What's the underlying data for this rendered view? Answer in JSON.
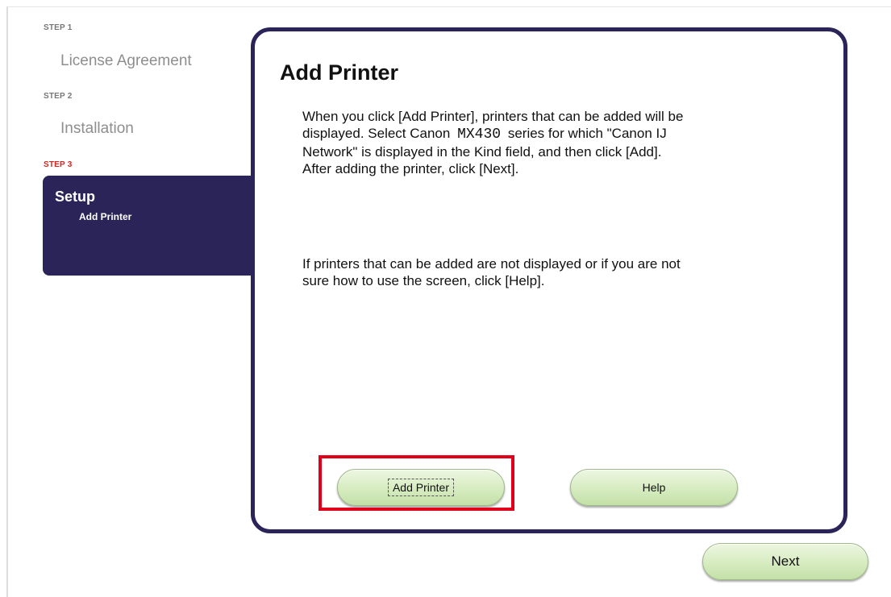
{
  "steps": [
    {
      "step_label": "STEP 1",
      "name": "License Agreement"
    },
    {
      "step_label": "STEP 2",
      "name": "Installation"
    },
    {
      "step_label": "STEP 3",
      "name": "Setup",
      "sub": "Add Printer"
    }
  ],
  "panel": {
    "title": "Add Printer",
    "para1_before_model": "When you click [Add Printer], printers that can be added will be\ndisplayed. Select Canon",
    "model": "MX430",
    "para1_after_model": "series for which \"Canon IJ\nNetwork\" is displayed in the Kind field, and then click [Add].\nAfter adding the printer, click [Next].",
    "para2": "If printers that can be added are not displayed or if you are not\nsure how to use the screen, click [Help]."
  },
  "buttons": {
    "add_printer": "Add Printer",
    "help": "Help",
    "next": "Next"
  },
  "colors": {
    "accent_navy": "#2a2458",
    "active_step_red": "#e0201a",
    "button_green": "#d6ecc0",
    "highlight_red": "#e0001a"
  }
}
